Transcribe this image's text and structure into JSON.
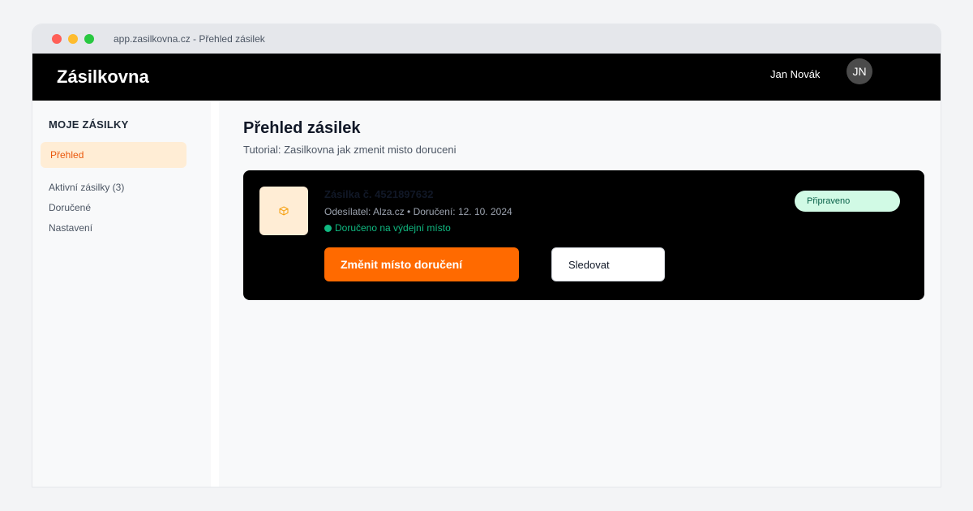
{
  "browser": {
    "url": "app.zasilkovna.cz - Přehled zásilek"
  },
  "header": {
    "brand": "Zásilkovna",
    "user_name": "Jan Novák",
    "avatar_initials": "JN"
  },
  "sidebar": {
    "heading": "MOJE ZÁSILKY",
    "items": [
      {
        "label": "Přehled",
        "active": true
      },
      {
        "label": "Aktivní zásilky (3)",
        "active": false
      },
      {
        "label": "Doručené",
        "active": false
      },
      {
        "label": "Nastavení",
        "active": false
      }
    ]
  },
  "main": {
    "title": "Přehled zásilek",
    "subtitle": "Tutorial: Zasilkovna jak zmenit misto doruceni",
    "package": {
      "icon": "package-icon",
      "title": "Zásilka č. 4521897632",
      "meta": "Odesílatel: Alza.cz • Doručení: 12. 10. 2024",
      "status": "Doručeno na výdejní místo",
      "badge": "Připraveno",
      "primary_action": "Změnit místo doručení",
      "secondary_action": "Sledovat"
    }
  },
  "colors": {
    "accent": "#ff6a00",
    "header_bg": "#000000",
    "status_green": "#10b981",
    "badge_bg": "#d1fae5"
  }
}
